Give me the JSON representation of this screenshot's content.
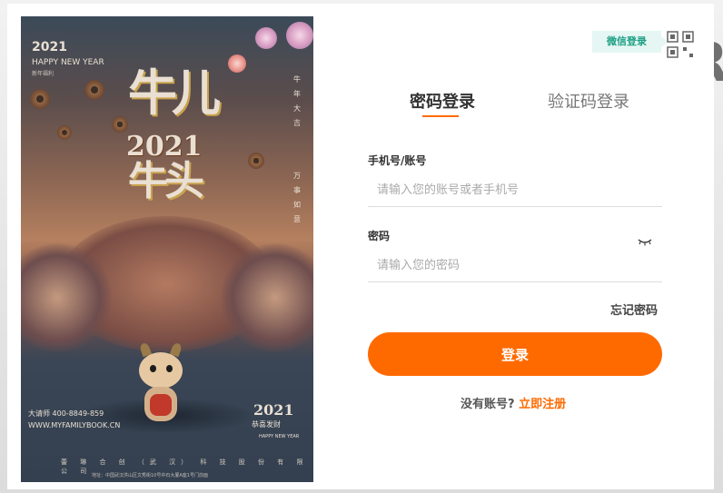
{
  "background": {
    "word": "R"
  },
  "poster": {
    "year": "2021",
    "greeting": "HAPPY NEW YEAR",
    "sub": "新年福利",
    "big_top": "牛儿",
    "center_year": "2021",
    "big_bottom": "牛头",
    "vertical_1": [
      "牛",
      "年",
      "大",
      "吉"
    ],
    "vertical_2": [
      "万",
      "事",
      "如",
      "意"
    ],
    "hotline": "大请师  400-8849-859",
    "url": "WWW.MYFAMILYBOOK.CN",
    "badge_year": "2021",
    "badge_text": "恭喜发财",
    "badge_sub": "HAPPY NEW YEAR",
    "company": "蕾 琳 合 创 （武 汉） 科 技 股 份 有 限 公 司",
    "address": "地址：中国武汉洪山区文秀街10号中石大厦A座1号门前面"
  },
  "qr": {
    "tip": "微信登录",
    "icon": "qr-code-icon"
  },
  "tabs": [
    {
      "label": "密码登录",
      "active": true
    },
    {
      "label": "验证码登录",
      "active": false
    }
  ],
  "form": {
    "account_label": "手机号/账号",
    "account_placeholder": "请输入您的账号或者手机号",
    "password_label": "密码",
    "password_placeholder": "请输入您的密码",
    "eye_icon": "eye-closed-icon",
    "forgot": "忘记密码",
    "submit": "登录",
    "no_account": "没有账号?",
    "register": "立即注册"
  },
  "colors": {
    "accent": "#ff6a00",
    "wechat": "#1b9e84"
  }
}
